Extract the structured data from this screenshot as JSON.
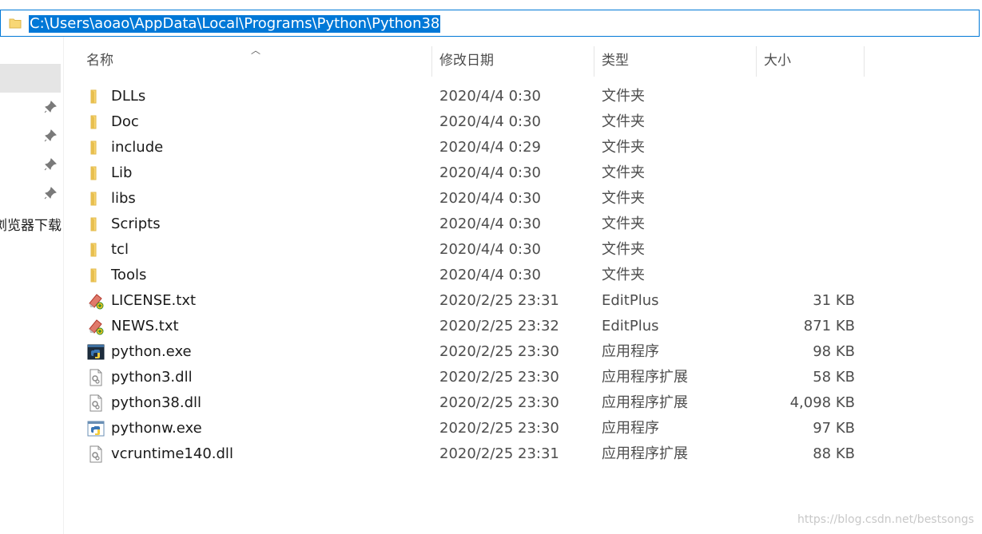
{
  "address_bar": {
    "path": "C:\\Users\\aoao\\AppData\\Local\\Programs\\Python\\Python38"
  },
  "nav": {
    "partial_label": "浏览器下载"
  },
  "columns": {
    "name": "名称",
    "date": "修改日期",
    "type": "类型",
    "size": "大小"
  },
  "files": [
    {
      "icon": "folder-icon",
      "name": "DLLs",
      "date": "2020/4/4 0:30",
      "type": "文件夹",
      "size": ""
    },
    {
      "icon": "folder-icon",
      "name": "Doc",
      "date": "2020/4/4 0:30",
      "type": "文件夹",
      "size": ""
    },
    {
      "icon": "folder-icon",
      "name": "include",
      "date": "2020/4/4 0:29",
      "type": "文件夹",
      "size": ""
    },
    {
      "icon": "folder-icon",
      "name": "Lib",
      "date": "2020/4/4 0:30",
      "type": "文件夹",
      "size": ""
    },
    {
      "icon": "folder-icon",
      "name": "libs",
      "date": "2020/4/4 0:30",
      "type": "文件夹",
      "size": ""
    },
    {
      "icon": "folder-icon",
      "name": "Scripts",
      "date": "2020/4/4 0:30",
      "type": "文件夹",
      "size": ""
    },
    {
      "icon": "folder-icon",
      "name": "tcl",
      "date": "2020/4/4 0:30",
      "type": "文件夹",
      "size": ""
    },
    {
      "icon": "folder-icon",
      "name": "Tools",
      "date": "2020/4/4 0:30",
      "type": "文件夹",
      "size": ""
    },
    {
      "icon": "editplus-file-icon",
      "name": "LICENSE.txt",
      "date": "2020/2/25 23:31",
      "type": "EditPlus",
      "size": "31 KB"
    },
    {
      "icon": "editplus-file-icon",
      "name": "NEWS.txt",
      "date": "2020/2/25 23:32",
      "type": "EditPlus",
      "size": "871 KB"
    },
    {
      "icon": "python-exe-icon",
      "name": "python.exe",
      "date": "2020/2/25 23:30",
      "type": "应用程序",
      "size": "98 KB"
    },
    {
      "icon": "dll-file-icon",
      "name": "python3.dll",
      "date": "2020/2/25 23:30",
      "type": "应用程序扩展",
      "size": "58 KB"
    },
    {
      "icon": "dll-file-icon",
      "name": "python38.dll",
      "date": "2020/2/25 23:30",
      "type": "应用程序扩展",
      "size": "4,098 KB"
    },
    {
      "icon": "pythonw-exe-icon",
      "name": "pythonw.exe",
      "date": "2020/2/25 23:30",
      "type": "应用程序",
      "size": "97 KB"
    },
    {
      "icon": "dll-file-icon",
      "name": "vcruntime140.dll",
      "date": "2020/2/25 23:31",
      "type": "应用程序扩展",
      "size": "88 KB"
    }
  ],
  "watermark": "https://blog.csdn.net/bestsongs",
  "colors": {
    "selection": "#0078d7",
    "folder": "#f8d775",
    "nav_selected": "#e5e5e5"
  }
}
